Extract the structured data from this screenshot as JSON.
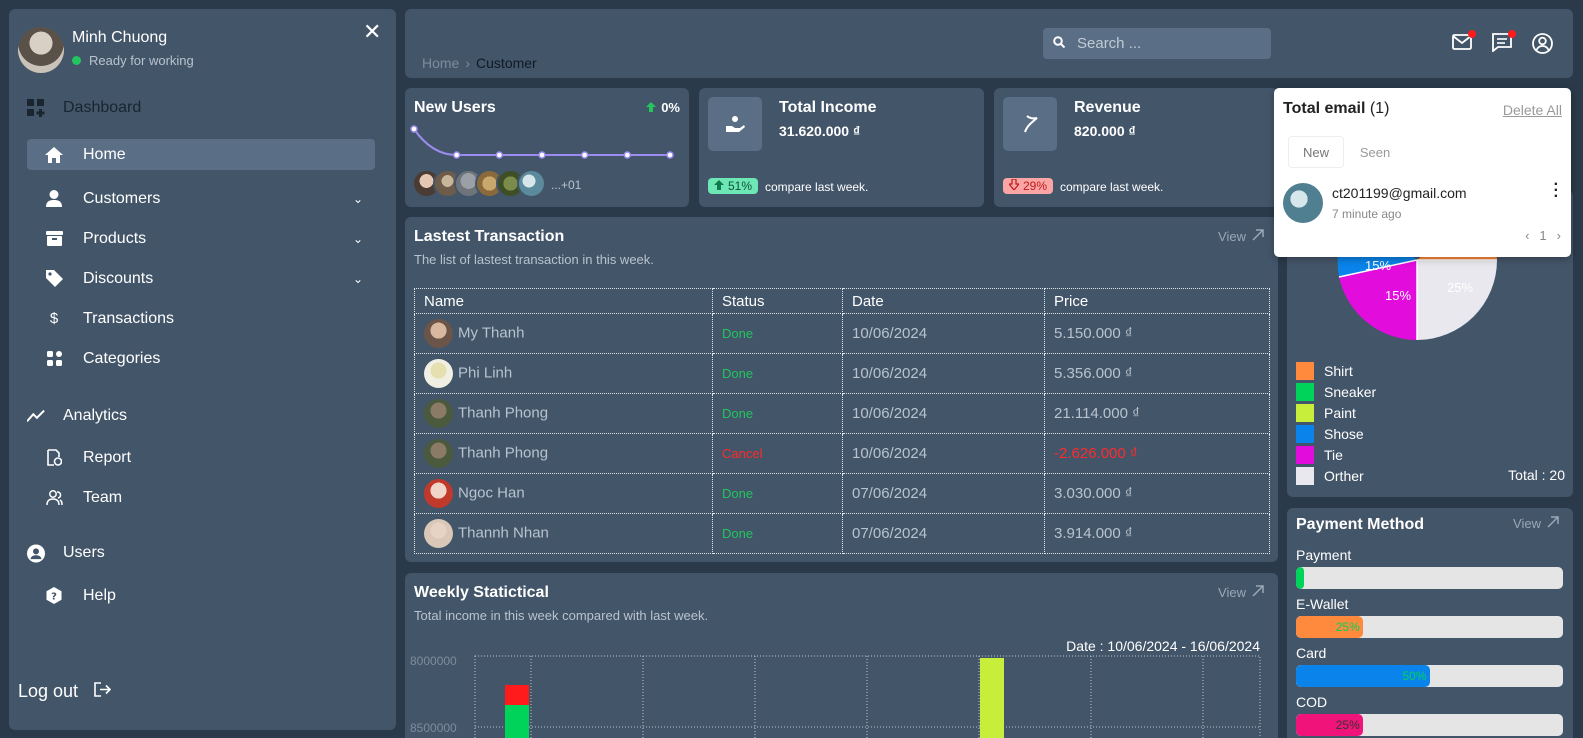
{
  "sidebar": {
    "user_name": "Minh Chuong",
    "user_status": "Ready for working",
    "sections": {
      "dashboard": "Dashboard",
      "analytics": "Analytics",
      "users": "Users"
    },
    "items": {
      "home": "Home",
      "customers": "Customers",
      "products": "Products",
      "discounts": "Discounts",
      "transactions": "Transactions",
      "categories": "Categories",
      "report": "Report",
      "team": "Team",
      "help": "Help"
    },
    "logout": "Log out"
  },
  "topbar": {
    "breadcrumb_home": "Home",
    "breadcrumb_current": "Customer",
    "search_placeholder": "Search ..."
  },
  "cards": {
    "new_users": {
      "title": "New Users",
      "change": "0%",
      "more": "...+01",
      "trend": [
        1.0,
        0,
        0,
        0,
        0,
        0,
        0
      ]
    },
    "income": {
      "title": "Total Income",
      "value": "31.620.000 ₫",
      "change": "51%",
      "compare": "compare last week."
    },
    "revenue": {
      "title": "Revenue",
      "value": "820.000 ₫",
      "change": "29%",
      "compare": "compare last week."
    }
  },
  "transactions": {
    "title": "Lastest Transaction",
    "subtitle": "The list of lastest transaction in this week.",
    "view": "View",
    "headers": [
      "Name",
      "Status",
      "Date",
      "Price"
    ],
    "rows": [
      {
        "name": "My Thanh",
        "status": "Done",
        "date": "10/06/2024",
        "price": "5.150.000 ₫"
      },
      {
        "name": "Phi Linh",
        "status": "Done",
        "date": "10/06/2024",
        "price": "5.356.000 ₫"
      },
      {
        "name": "Thanh Phong",
        "status": "Done",
        "date": "10/06/2024",
        "price": "21.114.000 ₫"
      },
      {
        "name": "Thanh Phong",
        "status": "Cancel",
        "date": "10/06/2024",
        "price": "-2.626.000 ₫"
      },
      {
        "name": "Ngoc Han",
        "status": "Done",
        "date": "07/06/2024",
        "price": "3.030.000 ₫"
      },
      {
        "name": "Thannh Nhan",
        "status": "Done",
        "date": "07/06/2024",
        "price": "3.914.000 ₫"
      }
    ]
  },
  "weekly": {
    "title": "Weekly Statictical",
    "subtitle": "Total income in this week compared with last week.",
    "view": "View",
    "date_range": "Date : 10/06/2024 - 16/06/2024",
    "y_ticks": [
      "8000000",
      "8500000"
    ]
  },
  "pie": {
    "labels": [
      "15%",
      "15%",
      "25%"
    ],
    "legend": [
      "Shirt",
      "Sneaker",
      "Paint",
      "Shose",
      "Tie",
      "Orther"
    ],
    "colors": [
      "#ff8a3d",
      "#00d35a",
      "#c6ee3a",
      "#0a84ea",
      "#e20ddc",
      "#e8e8ee"
    ],
    "total": "Total : 20"
  },
  "payment": {
    "title": "Payment Method",
    "view": "View",
    "methods": [
      {
        "label": "Payment",
        "value": 0.03,
        "text": "",
        "color": "#00d35a",
        "text_color": "#00d35a"
      },
      {
        "label": "E-Wallet",
        "value": 0.25,
        "text": "25%",
        "color": "#ff8a3d",
        "text_color": "#00d35a"
      },
      {
        "label": "Card",
        "value": 0.5,
        "text": "50%",
        "color": "#0a84ea",
        "text_color": "#00d35a"
      },
      {
        "label": "COD",
        "value": 0.25,
        "text": "25%",
        "color": "#f0147a",
        "text_color": "#333"
      }
    ]
  },
  "email_popup": {
    "title": "Total email",
    "count": "(1)",
    "delete_all": "Delete All",
    "tab_new": "New",
    "tab_seen": "Seen",
    "item_email": "ct201199@gmail.com",
    "item_time": "7 minute ago",
    "page": "1"
  }
}
